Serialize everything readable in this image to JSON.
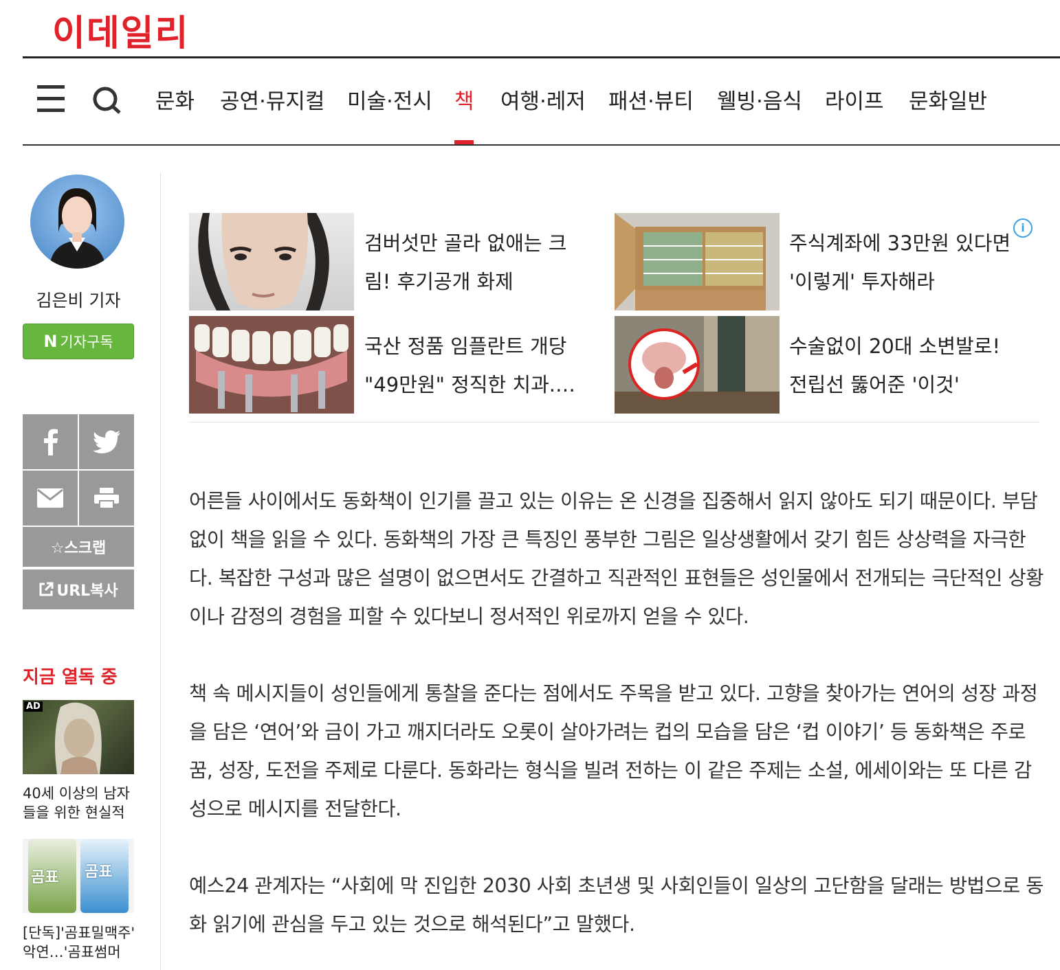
{
  "site": {
    "logo": "이데일리"
  },
  "nav": {
    "items": [
      "문화",
      "공연·뮤지컬",
      "미술·전시",
      "책",
      "여행·레저",
      "패션·뷰티",
      "웰빙·음식",
      "라이프",
      "문화일반"
    ],
    "active": "책"
  },
  "reporter": {
    "name": "김은비 기자",
    "subscribe_n": "N",
    "subscribe_label": "기자구독"
  },
  "share": {
    "scrap_label": "☆스크랩",
    "url_label": "URL복사"
  },
  "ads": [
    {
      "text": "검버섯만 골라 없애는 크림! 후기공개 화제"
    },
    {
      "text": "주식계좌에 33만원 있다면 '이렇게' 투자해라"
    },
    {
      "text": "국산 정품 임플란트 개당 \"49만원\" 정직한 치과.…"
    },
    {
      "text": "수술없이 20대 소변발로! 전립선 뚫어준 '이것'"
    }
  ],
  "ad_info": "i",
  "article": {
    "paragraphs": [
      "어른들 사이에서도 동화책이 인기를 끌고 있는 이유는 온 신경을 집중해서 읽지 않아도 되기 때문이다. 부담없이 책을 읽을 수 있다. 동화책의 가장 큰 특징인 풍부한 그림은 일상생활에서 갖기 힘든 상상력을 자극한다. 복잡한 구성과 많은 설명이 없으면서도 간결하고 직관적인 표현들은 성인물에서 전개되는 극단적인 상황이나 감정의 경험을 피할 수 있다보니 정서적인 위로까지 얻을 수 있다.",
      "책 속 메시지들이 성인들에게 통찰을 준다는 점에서도 주목을 받고 있다. 고향을 찾아가는 연어의 성장 과정을 담은 ‘연어’와 금이 가고 깨지더라도 오롯이 살아가려는 컵의 모습을 담은 ‘컵 이야기’ 등 동화책은 주로 꿈, 성장, 도전을 주제로 다룬다. 동화라는 형식을 빌려 전하는 이 같은 주제는 소설, 에세이와는 또 다른 감성으로 메시지를 전달한다.",
      "예스24 관계자는 “사회에 막 진입한 2030 사회 초년생 및 사회인들이 일상의 고단함을 달래는 방법으로 동화 읽기에 관심을 두고 있는 것으로 해석된다”고 말했다."
    ]
  },
  "sidebar": {
    "hot_title": "지금 열독 중",
    "items": [
      {
        "badge": "AD",
        "caption": "40세 이상의 남자들을 위한 현실적"
      },
      {
        "caption": "[단독]'곰표밀맥주' 악연…'곰표썸머",
        "can_text": "곰표"
      }
    ]
  }
}
